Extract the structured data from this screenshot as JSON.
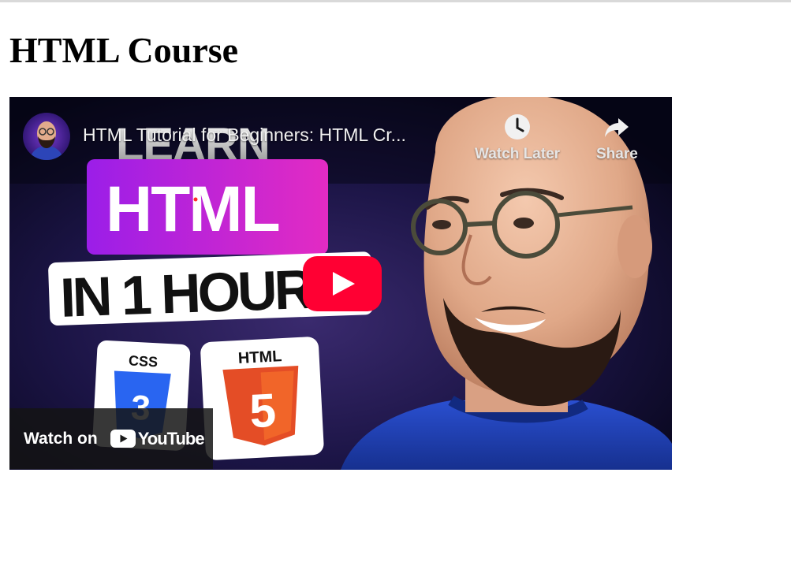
{
  "page": {
    "heading": "HTML Course"
  },
  "video": {
    "title": "HTML Tutorial for Beginners: HTML Cr...",
    "watch_later_label": "Watch Later",
    "share_label": "Share",
    "watch_on_label": "Watch on",
    "youtube_wordmark": "YouTube",
    "icons": {
      "watch_later": "clock-icon",
      "share": "share-arrow-icon",
      "play": "play-icon",
      "youtube": "youtube-logo-icon"
    },
    "thumbnail": {
      "headline_1": "LEARN",
      "headline_2": "HTML",
      "headline_3": "IN 1 HOUR",
      "badge_css": "CSS",
      "badge_html": "HTML",
      "badge_css_number": "3",
      "badge_html_number": "5"
    }
  },
  "colors": {
    "youtube_red": "#ff0033",
    "html5_orange": "#e44d26",
    "css3_blue": "#2965f1",
    "html_box_gradient_start": "#9b1ee8",
    "html_box_gradient_end": "#e32bc3",
    "sweater_blue": "#1f3fb0"
  }
}
